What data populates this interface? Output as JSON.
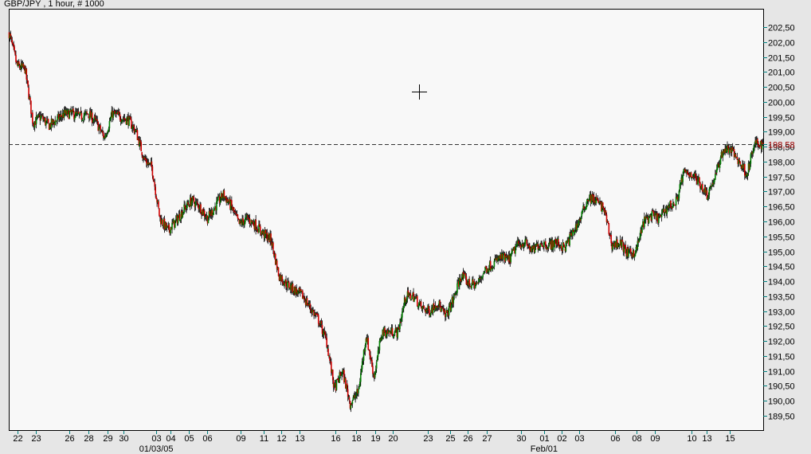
{
  "title": "GBP/JPY , 1 hour, # 1000",
  "chart_data": {
    "type": "candlestick",
    "title": "GBP/JPY , 1 hour, # 1000",
    "bars": 1000,
    "ylim": [
      189.2,
      203.1
    ],
    "y_ticks": [
      "202,50",
      "202,00",
      "201,50",
      "201,00",
      "200,50",
      "200,00",
      "199,50",
      "199,00",
      "198,50",
      "198,00",
      "197,50",
      "197,00",
      "196,50",
      "196,00",
      "195,50",
      "195,00",
      "194,50",
      "194,00",
      "193,50",
      "193,00",
      "192,50",
      "192,00",
      "191,50",
      "191,00",
      "190,50",
      "190,00",
      "189,50"
    ],
    "last_price": 198.58,
    "last_price_label": "198,58",
    "closes_sampled": [
      202.3,
      201.2,
      201.1,
      199.3,
      199.5,
      199.2,
      199.4,
      199.6,
      199.6,
      199.5,
      199.6,
      199.3,
      198.8,
      199.6,
      199.5,
      199.4,
      199.0,
      198.1,
      197.8,
      196.1,
      195.7,
      196.0,
      196.4,
      196.7,
      196.5,
      196.1,
      196.5,
      196.9,
      196.5,
      195.9,
      196.1,
      195.9,
      195.6,
      195.4,
      194.2,
      193.9,
      193.7,
      193.5,
      193.1,
      192.7,
      192.0,
      190.4,
      191.0,
      189.9,
      190.3,
      192.2,
      190.8,
      192.3,
      192.3,
      192.3,
      193.5,
      193.5,
      193.1,
      193.0,
      193.3,
      192.8,
      193.4,
      194.2,
      193.9,
      193.9,
      194.4,
      194.6,
      194.8,
      194.7,
      195.2,
      195.3,
      195.0,
      195.3,
      195.2,
      195.3,
      195.1,
      195.6,
      196.1,
      196.8,
      196.7,
      196.4,
      195.2,
      195.3,
      194.9,
      195.0,
      196.0,
      196.2,
      196.1,
      196.5,
      196.6,
      197.6,
      197.6,
      197.3,
      196.9,
      197.5,
      198.4,
      198.4,
      198.0,
      197.6,
      198.6,
      198.58
    ],
    "x_ticks": [
      {
        "label": "22",
        "bar": 11
      },
      {
        "label": "23",
        "bar": 35
      },
      {
        "label": "26",
        "bar": 80
      },
      {
        "label": "28",
        "bar": 105
      },
      {
        "label": "29",
        "bar": 130
      },
      {
        "label": "30",
        "bar": 152
      },
      {
        "label": "03",
        "bar": 195
      },
      {
        "label": "04",
        "bar": 214
      },
      {
        "label": "05",
        "bar": 238
      },
      {
        "label": "06",
        "bar": 262
      },
      {
        "label": "09",
        "bar": 307
      },
      {
        "label": "11",
        "bar": 337
      },
      {
        "label": "12",
        "bar": 361
      },
      {
        "label": "13",
        "bar": 385
      },
      {
        "label": "16",
        "bar": 432
      },
      {
        "label": "18",
        "bar": 460
      },
      {
        "label": "19",
        "bar": 485
      },
      {
        "label": "20",
        "bar": 508
      },
      {
        "label": "23",
        "bar": 555
      },
      {
        "label": "25",
        "bar": 584
      },
      {
        "label": "26",
        "bar": 608
      },
      {
        "label": "27",
        "bar": 633
      },
      {
        "label": "30",
        "bar": 679
      },
      {
        "label": "01",
        "bar": 709
      },
      {
        "label": "02",
        "bar": 732
      },
      {
        "label": "03",
        "bar": 756
      },
      {
        "label": "06",
        "bar": 803
      },
      {
        "label": "08",
        "bar": 832
      },
      {
        "label": "09",
        "bar": 856
      },
      {
        "label": "10",
        "bar": 904
      },
      {
        "label": "13",
        "bar": 925
      },
      {
        "label": "15",
        "bar": 955
      }
    ],
    "x_period_labels": [
      {
        "label": "01/03/05",
        "bar": 195
      },
      {
        "label": "Feb/01",
        "bar": 709
      }
    ],
    "colors": {
      "up": "#008000",
      "down": "#d00000",
      "wick": "#000000",
      "last_line": "#800000",
      "tick": "#008080"
    }
  }
}
